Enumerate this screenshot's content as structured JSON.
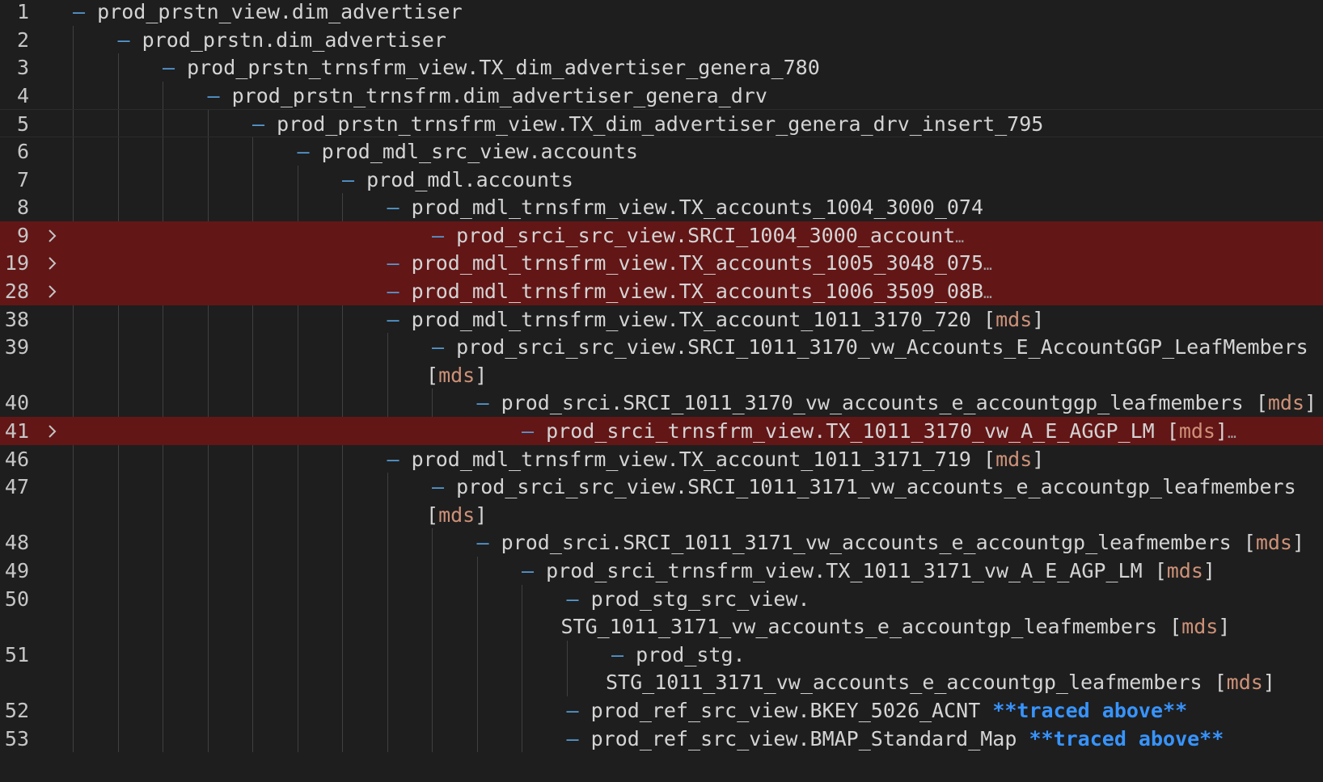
{
  "editor": {
    "theme": {
      "background": "#1e1e1e",
      "highlight_background": "#631616",
      "line_number_color": "#c6c6c6",
      "text_color": "#d4d4d4",
      "dash_color": "#569cd6",
      "tag_color": "#ce9178",
      "traced_color": "#3794ff"
    },
    "icons": {
      "folded": "chevron-right-icon",
      "collapsed_content": "ellipsis-icon",
      "spell_squiggle": "wavy-underline"
    },
    "lines": [
      {
        "num": "1",
        "depth": 0,
        "text": "prod_prstn_view.dim_advertiser",
        "suffix": "",
        "folded": false,
        "highlight": false
      },
      {
        "num": "2",
        "depth": 1,
        "text": "prod_prstn.dim_advertiser",
        "suffix": "",
        "folded": false,
        "highlight": false
      },
      {
        "num": "3",
        "depth": 2,
        "text": "prod_prstn_trnsfrm_view.TX_dim_advertiser_genera_780",
        "suffix": "",
        "folded": false,
        "highlight": false
      },
      {
        "num": "4",
        "depth": 3,
        "text": "prod_prstn_trnsfrm.dim_advertiser_genera_drv",
        "suffix": "",
        "folded": false,
        "highlight": false
      },
      {
        "num": "5",
        "depth": 4,
        "text": "prod_prstn_trnsfrm_view.TX_dim_advertiser_genera_drv_insert_795",
        "suffix": "",
        "folded": false,
        "highlight": false,
        "current": true
      },
      {
        "num": "6",
        "depth": 5,
        "text": "prod_mdl_src_view.accounts",
        "suffix": "",
        "folded": false,
        "highlight": false
      },
      {
        "num": "7",
        "depth": 6,
        "text": "prod_mdl.accounts",
        "suffix": "",
        "folded": false,
        "highlight": false
      },
      {
        "num": "8",
        "depth": 7,
        "text": "prod_mdl_trnsfrm_view.TX_accounts_1004_3000_074",
        "suffix": "",
        "folded": false,
        "highlight": false
      },
      {
        "num": "9",
        "depth": 8,
        "text": "prod_srci_src_view.SRCI_1004_3000_account",
        "suffix": "",
        "folded": true,
        "highlight": true
      },
      {
        "num": "19",
        "depth": 7,
        "text": "prod_mdl_trnsfrm_view.TX_accounts_1005_3048_075",
        "suffix": "",
        "folded": true,
        "highlight": true
      },
      {
        "num": "28",
        "depth": 7,
        "text": "prod_mdl_trnsfrm_view.TX_accounts_1006_3509_08B",
        "suffix": "",
        "folded": true,
        "highlight": true
      },
      {
        "num": "38",
        "depth": 7,
        "text": "prod_mdl_trnsfrm_view.TX_account_1011_3170_720",
        "suffix": "mds",
        "folded": false,
        "highlight": false
      },
      {
        "num": "39",
        "depth": 8,
        "text": "prod_srci_src_view.SRCI_1011_3170_vw_Accounts_E_AccountGGP_LeafMembers",
        "suffix": "",
        "folded": false,
        "highlight": false
      },
      {
        "num": "",
        "depth": 8,
        "cont": "",
        "suffix": "mds",
        "folded": false,
        "highlight": false
      },
      {
        "num": "40",
        "depth": 9,
        "text": "prod_srci.SRCI_1011_3170_vw_accounts_e_accountggp_leafmembers",
        "suffix": "mds",
        "folded": false,
        "highlight": false
      },
      {
        "num": "41",
        "depth": 10,
        "text": "prod_srci_trnsfrm_view.TX_1011_3170_vw_A_E_AGGP_LM",
        "suffix": "mds",
        "folded": true,
        "highlight": true
      },
      {
        "num": "46",
        "depth": 7,
        "text": "prod_mdl_trnsfrm_view.TX_account_1011_3171_719",
        "suffix": "mds",
        "folded": false,
        "highlight": false
      },
      {
        "num": "47",
        "depth": 8,
        "text": "prod_srci_src_view.SRCI_1011_3171_vw_accounts_e_accountgp_leafmembers",
        "suffix": "",
        "folded": false,
        "highlight": false
      },
      {
        "num": "",
        "depth": 8,
        "cont": "",
        "suffix": "mds",
        "folded": false,
        "highlight": false
      },
      {
        "num": "48",
        "depth": 9,
        "text": "prod_srci.SRCI_1011_3171_vw_accounts_e_accountgp_leafmembers",
        "suffix": "mds",
        "folded": false,
        "highlight": false
      },
      {
        "num": "49",
        "depth": 10,
        "text": "prod_srci_trnsfrm_view.TX_1011_3171_vw_A_E_AGP_LM",
        "suffix": "mds",
        "folded": false,
        "highlight": false
      },
      {
        "num": "50",
        "depth": 11,
        "text": "prod_stg_src_view.",
        "suffix": "",
        "folded": false,
        "highlight": false
      },
      {
        "num": "",
        "depth": 11,
        "cont": "STG_1011_3171_vw_accounts_e_accountgp_leafmembers",
        "suffix": "mds",
        "folded": false,
        "highlight": false
      },
      {
        "num": "51",
        "depth": 12,
        "text": "prod_stg.",
        "suffix": "",
        "folded": false,
        "highlight": false
      },
      {
        "num": "",
        "depth": 12,
        "cont": "STG_1011_3171_vw_accounts_e_accountgp_leafmembers",
        "suffix": "mds",
        "folded": false,
        "highlight": false
      },
      {
        "num": "52",
        "depth": 11,
        "text": "prod_ref_src_view.BKEY_5026_ACNT",
        "suffix": "",
        "traced": "**traced above**",
        "folded": false,
        "highlight": false
      },
      {
        "num": "53",
        "depth": 11,
        "text": "prod_ref_src_view.BMAP_Standard_Map",
        "suffix": "",
        "traced": "**traced above**",
        "folded": false,
        "highlight": false
      }
    ]
  }
}
